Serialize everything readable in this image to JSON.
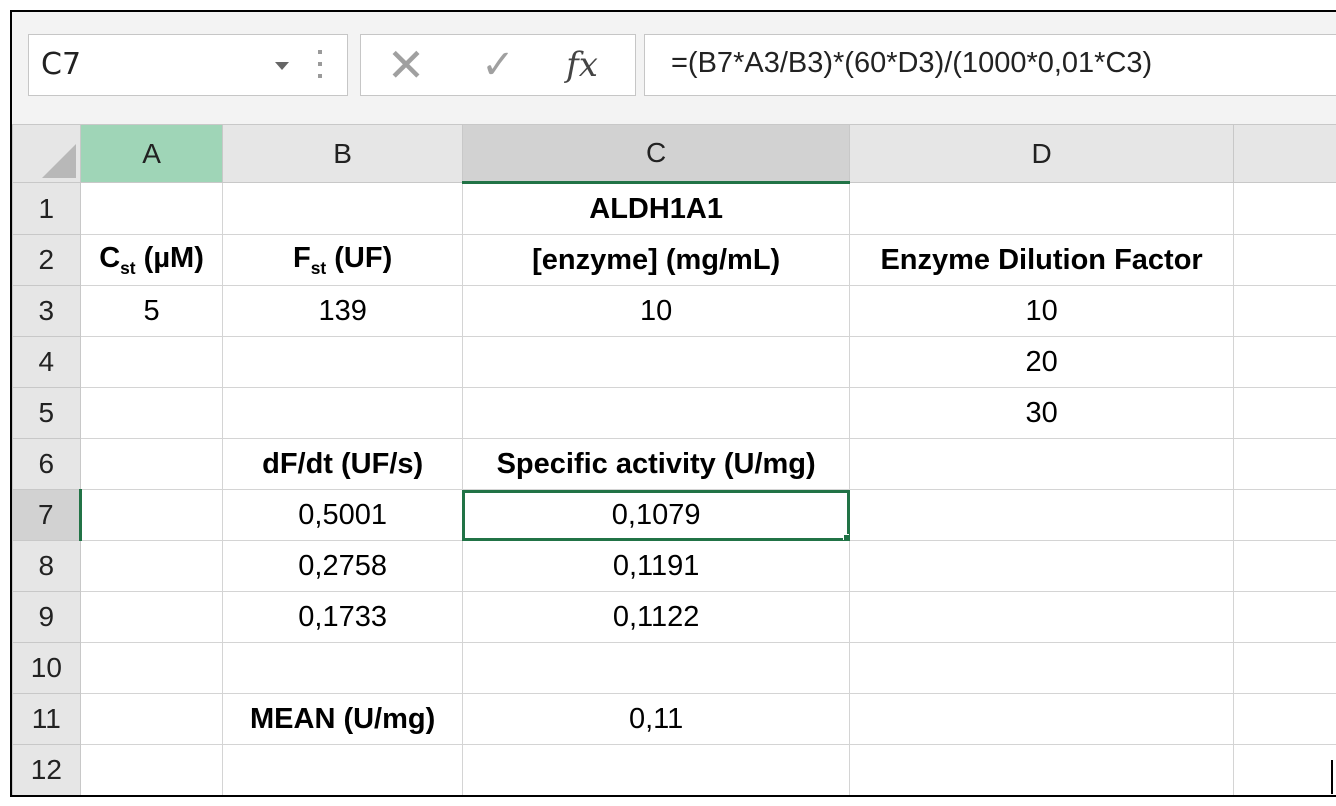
{
  "name_box": "C7",
  "formula_bar": {
    "cancel_icon": "close-icon",
    "enter_icon": "checkmark-icon",
    "function_icon": "fx",
    "formula": "=(B7*A3/B3)*(60*D3)/(1000*0,01*C3)"
  },
  "columns": [
    "A",
    "B",
    "C",
    "D"
  ],
  "rows": [
    "1",
    "2",
    "3",
    "4",
    "5",
    "6",
    "7",
    "8",
    "9",
    "10",
    "11",
    "12"
  ],
  "cells": {
    "C1": "ALDH1A1",
    "A2_main": "C",
    "A2_sub": "st",
    "A2_rest": " (µM)",
    "B2_main": "F",
    "B2_sub": "st",
    "B2_rest": " (UF)",
    "C2": "[enzyme] (mg/mL)",
    "D2": "Enzyme Dilution Factor",
    "A3": "5",
    "B3": "139",
    "C3": "10",
    "D3": "10",
    "D4": "20",
    "D5": "30",
    "B6": "dF/dt (UF/s)",
    "C6": "Specific activity (U/mg)",
    "B7": "0,5001",
    "C7": "0,1079",
    "B8": "0,2758",
    "C8": "0,1191",
    "B9": "0,1733",
    "C9": "0,1122",
    "B11": "MEAN (U/mg)",
    "C11": "0,11"
  },
  "colors": {
    "selection": "#217346",
    "header_bg": "#e6e6e6",
    "selected_header_bg": "#d2d2d2",
    "column_a_header_bg": "#9fd5b7"
  }
}
